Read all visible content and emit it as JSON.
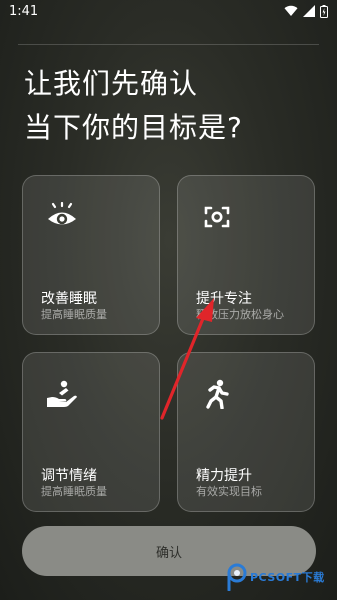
{
  "status_bar": {
    "time": "1:41"
  },
  "headline": {
    "line1": "让我们先确认",
    "line2": "当下你的目标是?"
  },
  "cards": [
    {
      "title": "改善睡眠",
      "subtitle": "提高睡眠质量",
      "icon": "eye-icon"
    },
    {
      "title": "提升专注",
      "subtitle": "释放压力放松身心",
      "icon": "focus-icon"
    },
    {
      "title": "调节情绪",
      "subtitle": "提高睡眠质量",
      "icon": "hand-care-icon"
    },
    {
      "title": "精力提升",
      "subtitle": "有效实现目标",
      "icon": "running-person-icon"
    }
  ],
  "confirm_label": "确认",
  "watermark": {
    "text": "PCSOFT下载"
  },
  "colors": {
    "annotation_arrow": "#e0252a",
    "watermark": "#2a7bd6"
  }
}
